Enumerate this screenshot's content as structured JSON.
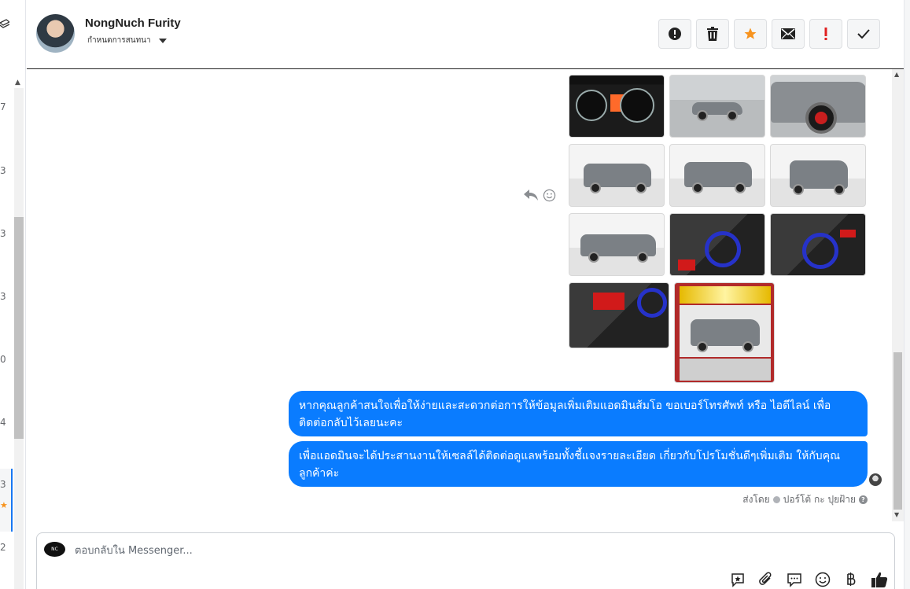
{
  "left_strip": {
    "numbers": [
      "7",
      "3",
      "3",
      "3",
      "0",
      "4",
      "3",
      "2"
    ]
  },
  "header": {
    "contact_name": "NongNuch Furity",
    "assign_label": "กำหนดการสนทนา",
    "actions": [
      {
        "name": "mark-spam-button",
        "icon": "alert-circle-icon"
      },
      {
        "name": "delete-button",
        "icon": "trash-icon"
      },
      {
        "name": "star-button",
        "icon": "star-icon",
        "color": "#f7931e"
      },
      {
        "name": "mark-unread-button",
        "icon": "envelope-icon"
      },
      {
        "name": "important-button",
        "icon": "exclamation-icon",
        "color": "#e02020"
      },
      {
        "name": "done-button",
        "icon": "check-icon"
      }
    ]
  },
  "thread": {
    "photos_count": 11,
    "messages": [
      {
        "text": "หากคุณลูกค้าสนใจเพื่อให้ง่ายและสะดวกต่อการให้ข้อมูลเพิ่มเติมแอดมินส้มโอ ขอเบอร์โทรศัพท์ หรือ ไอดีไลน์ เพื่อติดต่อกลับไว้เลยนะคะ"
      },
      {
        "text": "เพื่อแอดมินจะได้ประสานงานให้เซลล์ได้ติดต่อดูแลพร้อมทั้งชี้แจงรายละเอียด เกี่ยวกับโปรโมชั่นดีๆเพิ่มเติม ให้กับคุณลูกค้าค่ะ"
      }
    ],
    "sent_by_label": "ส่งโดย",
    "sent_by_name": "ปอร์โต้ กะ ปุยฝ้าย"
  },
  "composer": {
    "placeholder": "ตอบกลับใน Messenger...",
    "tools": [
      "saved-reply-icon",
      "attachment-icon",
      "comment-icon",
      "emoji-icon",
      "baht-icon",
      "thumbs-up-icon"
    ]
  },
  "colors": {
    "bubble": "#0a7cff",
    "accent": "#1877f2",
    "star": "#f7931e"
  }
}
